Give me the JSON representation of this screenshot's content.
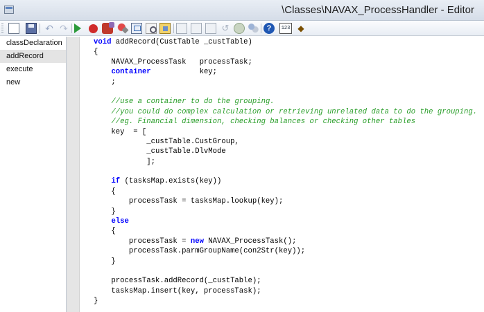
{
  "window": {
    "title": "\\Classes\\NAVAX_ProcessHandler - Editor"
  },
  "toolbar": {
    "buttons": [
      {
        "name": "new-icon"
      },
      {
        "name": "save-icon"
      },
      {
        "name": "undo-icon"
      },
      {
        "name": "redo-icon"
      },
      {
        "name": "run-icon"
      },
      {
        "name": "breakpoint-icon"
      },
      {
        "name": "breakpoint-remove-icon"
      },
      {
        "name": "clear-breakpoints-icon"
      },
      {
        "name": "compile-icon"
      },
      {
        "name": "find-icon"
      },
      {
        "name": "properties-icon"
      },
      {
        "name": "document-icon"
      },
      {
        "name": "document-icon"
      },
      {
        "name": "document-icon"
      },
      {
        "name": "back-icon"
      },
      {
        "name": "globe-icon"
      },
      {
        "name": "users-icon"
      },
      {
        "name": "help-icon"
      },
      {
        "name": "number-icon"
      },
      {
        "name": "special-icon"
      }
    ],
    "help_glyph": "?",
    "number_label": "123"
  },
  "methods": [
    {
      "label": "classDeclaration",
      "selected": false
    },
    {
      "label": "addRecord",
      "selected": true
    },
    {
      "label": "execute",
      "selected": false
    },
    {
      "label": "new",
      "selected": false
    }
  ],
  "code": {
    "lines": [
      [
        {
          "t": "void",
          "k": "kw"
        },
        {
          "t": " addRecord(CustTable _custTable)"
        }
      ],
      [
        {
          "t": "{"
        }
      ],
      [
        {
          "t": "    NAVAX_ProcessTask   processTask;"
        }
      ],
      [
        {
          "t": "    "
        },
        {
          "t": "container",
          "k": "kw"
        },
        {
          "t": "           key;"
        }
      ],
      [
        {
          "t": "    ;"
        }
      ],
      [
        {
          "t": ""
        }
      ],
      [
        {
          "t": "    "
        },
        {
          "t": "//use a container to do the grouping.",
          "k": "cm"
        }
      ],
      [
        {
          "t": "    "
        },
        {
          "t": "//you could do complex calculation or retrieving unrelated data to do the grouping.",
          "k": "cm"
        }
      ],
      [
        {
          "t": "    "
        },
        {
          "t": "//eg. Financial dimension, checking balances or checking other tables",
          "k": "cm"
        }
      ],
      [
        {
          "t": "    key  = ["
        }
      ],
      [
        {
          "t": "            _custTable.CustGroup,"
        }
      ],
      [
        {
          "t": "            _custTable.DlvMode"
        }
      ],
      [
        {
          "t": "            ];"
        }
      ],
      [
        {
          "t": ""
        }
      ],
      [
        {
          "t": "    "
        },
        {
          "t": "if",
          "k": "kw"
        },
        {
          "t": " (tasksMap.exists(key))"
        }
      ],
      [
        {
          "t": "    {"
        }
      ],
      [
        {
          "t": "        processTask = tasksMap.lookup(key);"
        }
      ],
      [
        {
          "t": "    }"
        }
      ],
      [
        {
          "t": "    "
        },
        {
          "t": "else",
          "k": "kw"
        }
      ],
      [
        {
          "t": "    {"
        }
      ],
      [
        {
          "t": "        processTask = "
        },
        {
          "t": "new",
          "k": "kw"
        },
        {
          "t": " NAVAX_ProcessTask();"
        }
      ],
      [
        {
          "t": "        processTask.parmGroupName(con2Str(key));"
        }
      ],
      [
        {
          "t": "    }"
        }
      ],
      [
        {
          "t": ""
        }
      ],
      [
        {
          "t": "    processTask.addRecord(_custTable);"
        }
      ],
      [
        {
          "t": "    tasksMap.insert(key, processTask);"
        }
      ],
      [
        {
          "t": "}"
        }
      ]
    ]
  }
}
